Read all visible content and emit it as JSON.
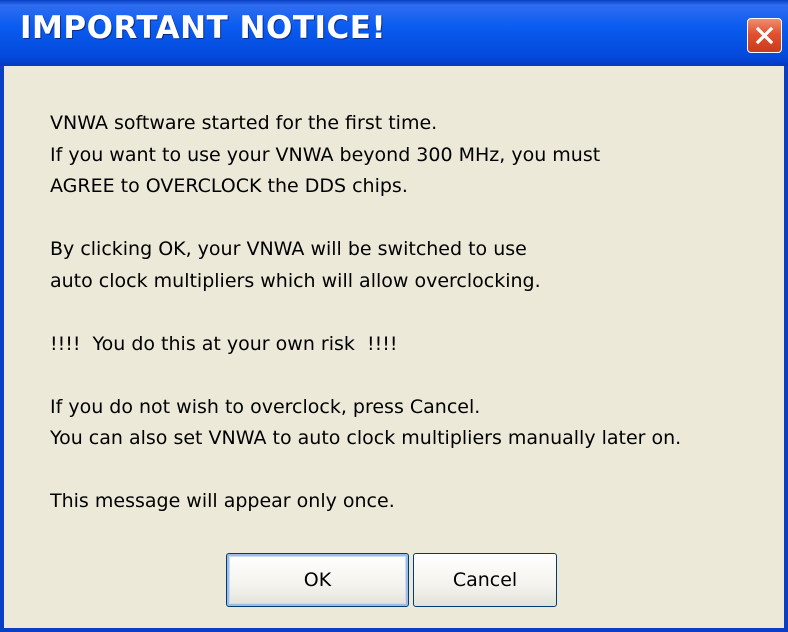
{
  "dialog": {
    "title": "IMPORTANT NOTICE!",
    "close_icon": "close-icon",
    "message": {
      "l1": "VNWA software started for the first time.",
      "l2": "If you want to use your VNWA beyond 300 MHz, you must",
      "l3": "AGREE to OVERCLOCK the DDS chips.",
      "l4": "By clicking OK, your VNWA will be switched to use",
      "l5": "auto clock multipliers which will allow overclocking.",
      "l6": "!!!!  You do this at your own risk  !!!!",
      "l7": "If you do not wish to overclock, press Cancel.",
      "l8": "You can also set VNWA to auto clock multipliers manually later on.",
      "l9": "This message will appear only once."
    },
    "buttons": {
      "ok_label": "OK",
      "cancel_label": "Cancel"
    }
  },
  "colors": {
    "titlebar": "#0a5cf0",
    "dialog_bg": "#ece9d8",
    "close_button": "#e3512f"
  }
}
